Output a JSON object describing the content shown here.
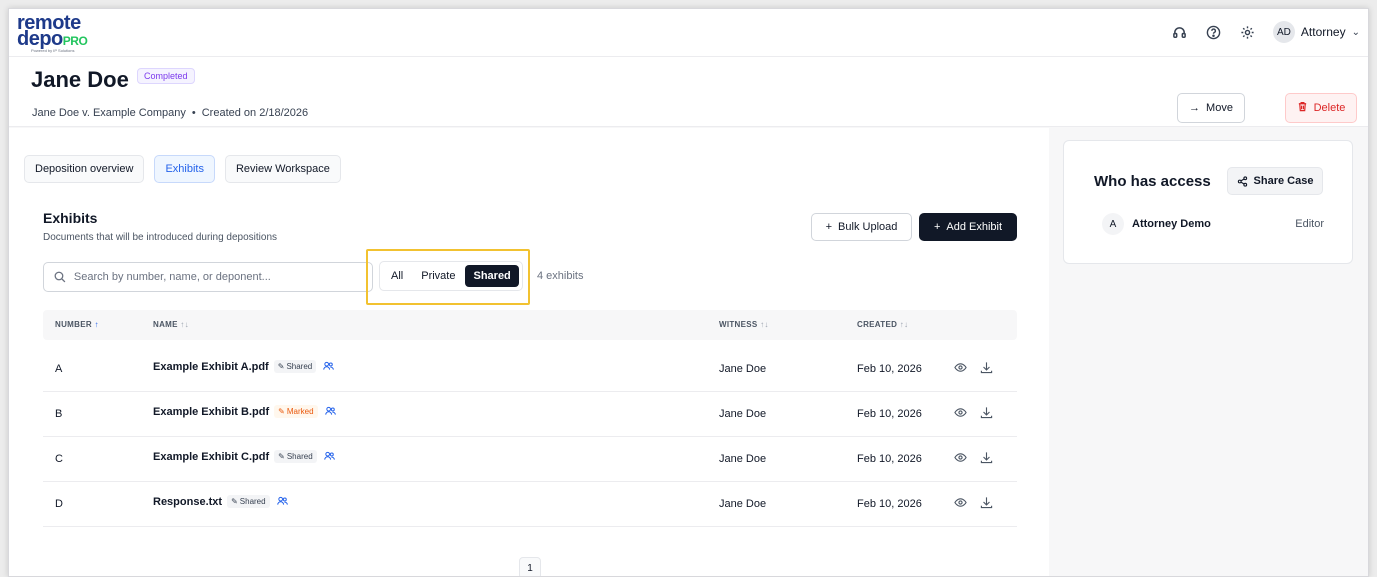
{
  "brand": {
    "line1": "remote",
    "line2": "depo",
    "pro": "PRO",
    "tagline": "Powered by IP Solutions"
  },
  "topbar": {
    "avatar_initials": "AD",
    "user_label": "Attorney"
  },
  "case": {
    "name": "Jane Doe",
    "status": "Completed",
    "caption": "Jane Doe v. Example Company",
    "separator": "•",
    "created": "Created on 2/18/2026"
  },
  "actions": {
    "move_label": "Move",
    "delete_label": "Delete"
  },
  "tabs": [
    {
      "label": "Deposition overview",
      "active": false
    },
    {
      "label": "Exhibits",
      "active": true
    },
    {
      "label": "Review Workspace",
      "active": false
    }
  ],
  "exhibits": {
    "title": "Exhibits",
    "subtitle": "Documents that will be introduced during depositions",
    "bulk_upload_label": "Bulk Upload",
    "add_exhibit_label": "Add Exhibit",
    "search_placeholder": "Search by number, name, or deponent...",
    "filters": [
      "All",
      "Private",
      "Shared"
    ],
    "active_filter": "Shared",
    "count_label": "4 exhibits",
    "columns": {
      "number": "NUMBER",
      "name": "NAME",
      "witness": "WITNESS",
      "created": "CREATED"
    },
    "rows": [
      {
        "number": "A",
        "name": "Example Exhibit A.pdf",
        "tag": "Shared",
        "witness": "Jane Doe",
        "created": "Feb 10, 2026"
      },
      {
        "number": "B",
        "name": "Example Exhibit B.pdf",
        "tag": "Marked",
        "witness": "Jane Doe",
        "created": "Feb 10, 2026"
      },
      {
        "number": "C",
        "name": "Example Exhibit C.pdf",
        "tag": "Shared",
        "witness": "Jane Doe",
        "created": "Feb 10, 2026"
      },
      {
        "number": "D",
        "name": "Response.txt",
        "tag": "Shared",
        "witness": "Jane Doe",
        "created": "Feb 10, 2026"
      }
    ],
    "page": "1"
  },
  "access": {
    "title": "Who has access",
    "share_label": "Share Case",
    "members": [
      {
        "initial": "A",
        "name": "Attorney Demo",
        "role": "Editor"
      }
    ]
  },
  "colors": {
    "accent": "#2563eb",
    "dark": "#111827",
    "danger": "#dc2626",
    "highlight": "#f2c230",
    "status": "#7c3aed",
    "marked": "#ea580c"
  }
}
